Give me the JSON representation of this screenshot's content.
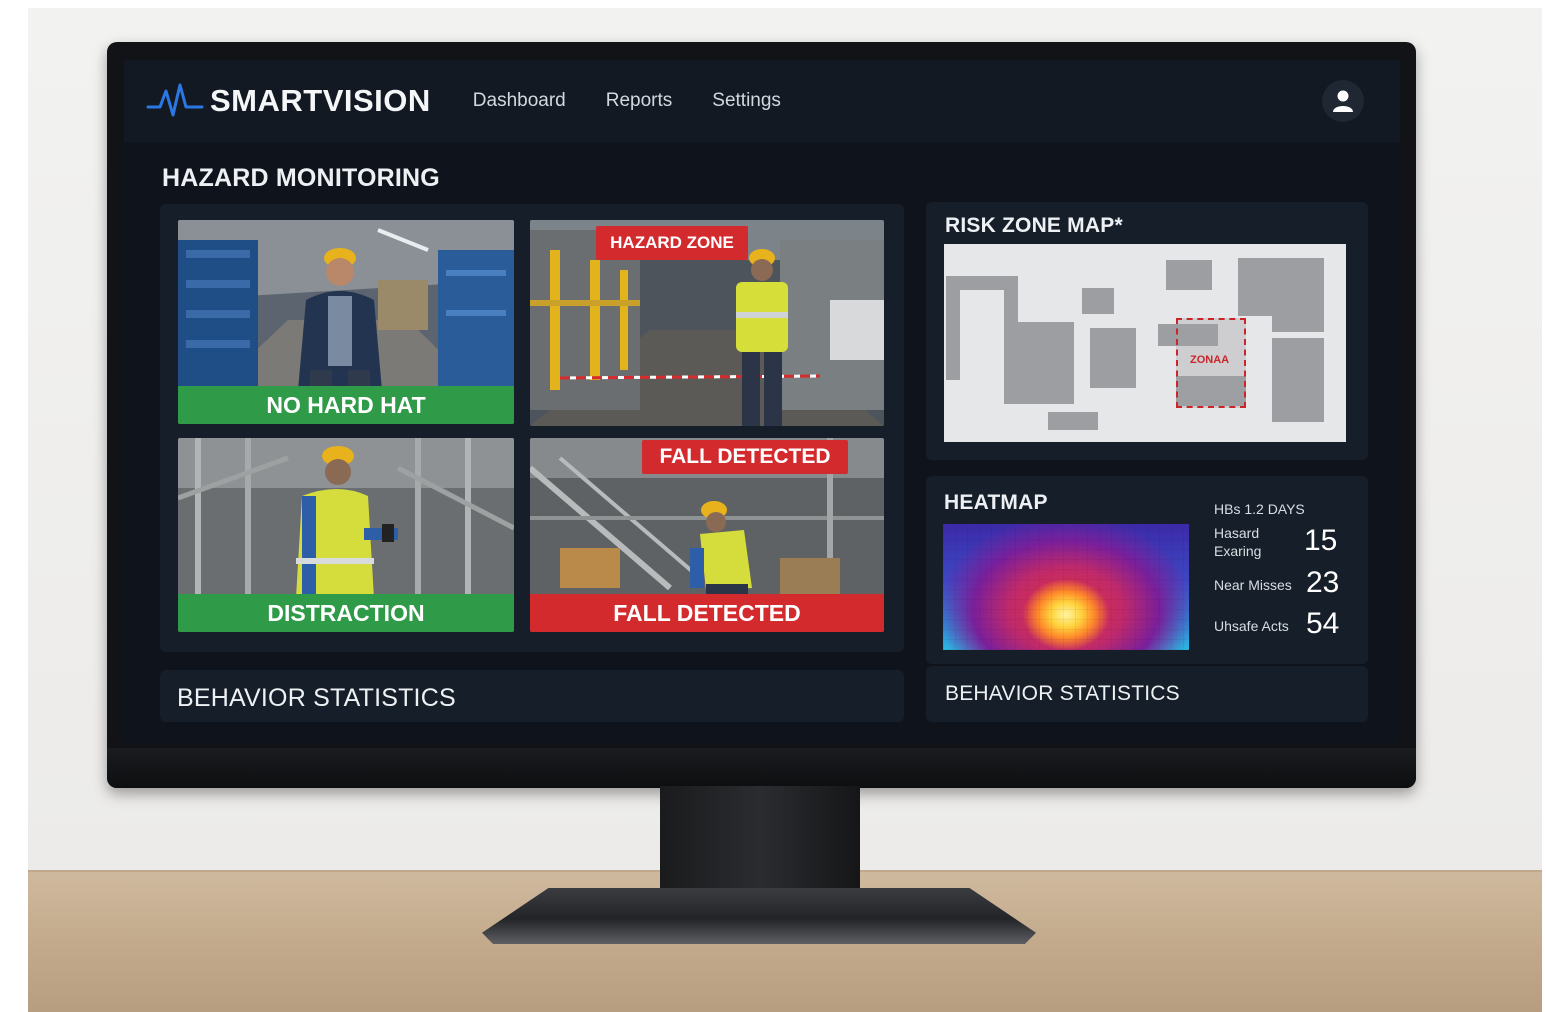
{
  "app": {
    "brand": "SMARTVISION",
    "nav": [
      {
        "label": "Dashboard"
      },
      {
        "label": "Reports"
      },
      {
        "label": "Settings"
      }
    ]
  },
  "hazard_monitoring": {
    "title": "HAZARD MONITORING",
    "cameras": [
      {
        "label": "NO HARD HAT",
        "status_color": "#2f9a48"
      },
      {
        "label": "HAZARD ZONE",
        "overlay": "HAZARD ZONE",
        "status_color": "#d32a2e"
      },
      {
        "label": "DISTRACTION",
        "status_color": "#2f9a48"
      },
      {
        "label": "FALL DETECTED",
        "overlay": "FALL DETECTED",
        "status_color": "#d32a2e"
      }
    ]
  },
  "risk_zone_map": {
    "title": "RISK ZONE MAP*",
    "zone_label": "ZONAA"
  },
  "heatmap": {
    "title": "HEATMAP",
    "period": "HBs 1.2 DAYS",
    "stats": [
      {
        "label_line1": "Hasard",
        "label_line2": "Exaring",
        "value": "15"
      },
      {
        "label_line1": "Near Misses",
        "label_line2": "",
        "value": "23"
      },
      {
        "label_line1": "Uhsafe Acts",
        "label_line2": "",
        "value": "54"
      }
    ]
  },
  "behavior_statistics": {
    "left_title": "BEHAVIOR STATISTICS",
    "right_title": "BEHAVIOR STATISTICS"
  },
  "colors": {
    "accent_blue": "#2b78e4",
    "alert_red": "#d32a2e",
    "ok_green": "#2f9a48"
  }
}
